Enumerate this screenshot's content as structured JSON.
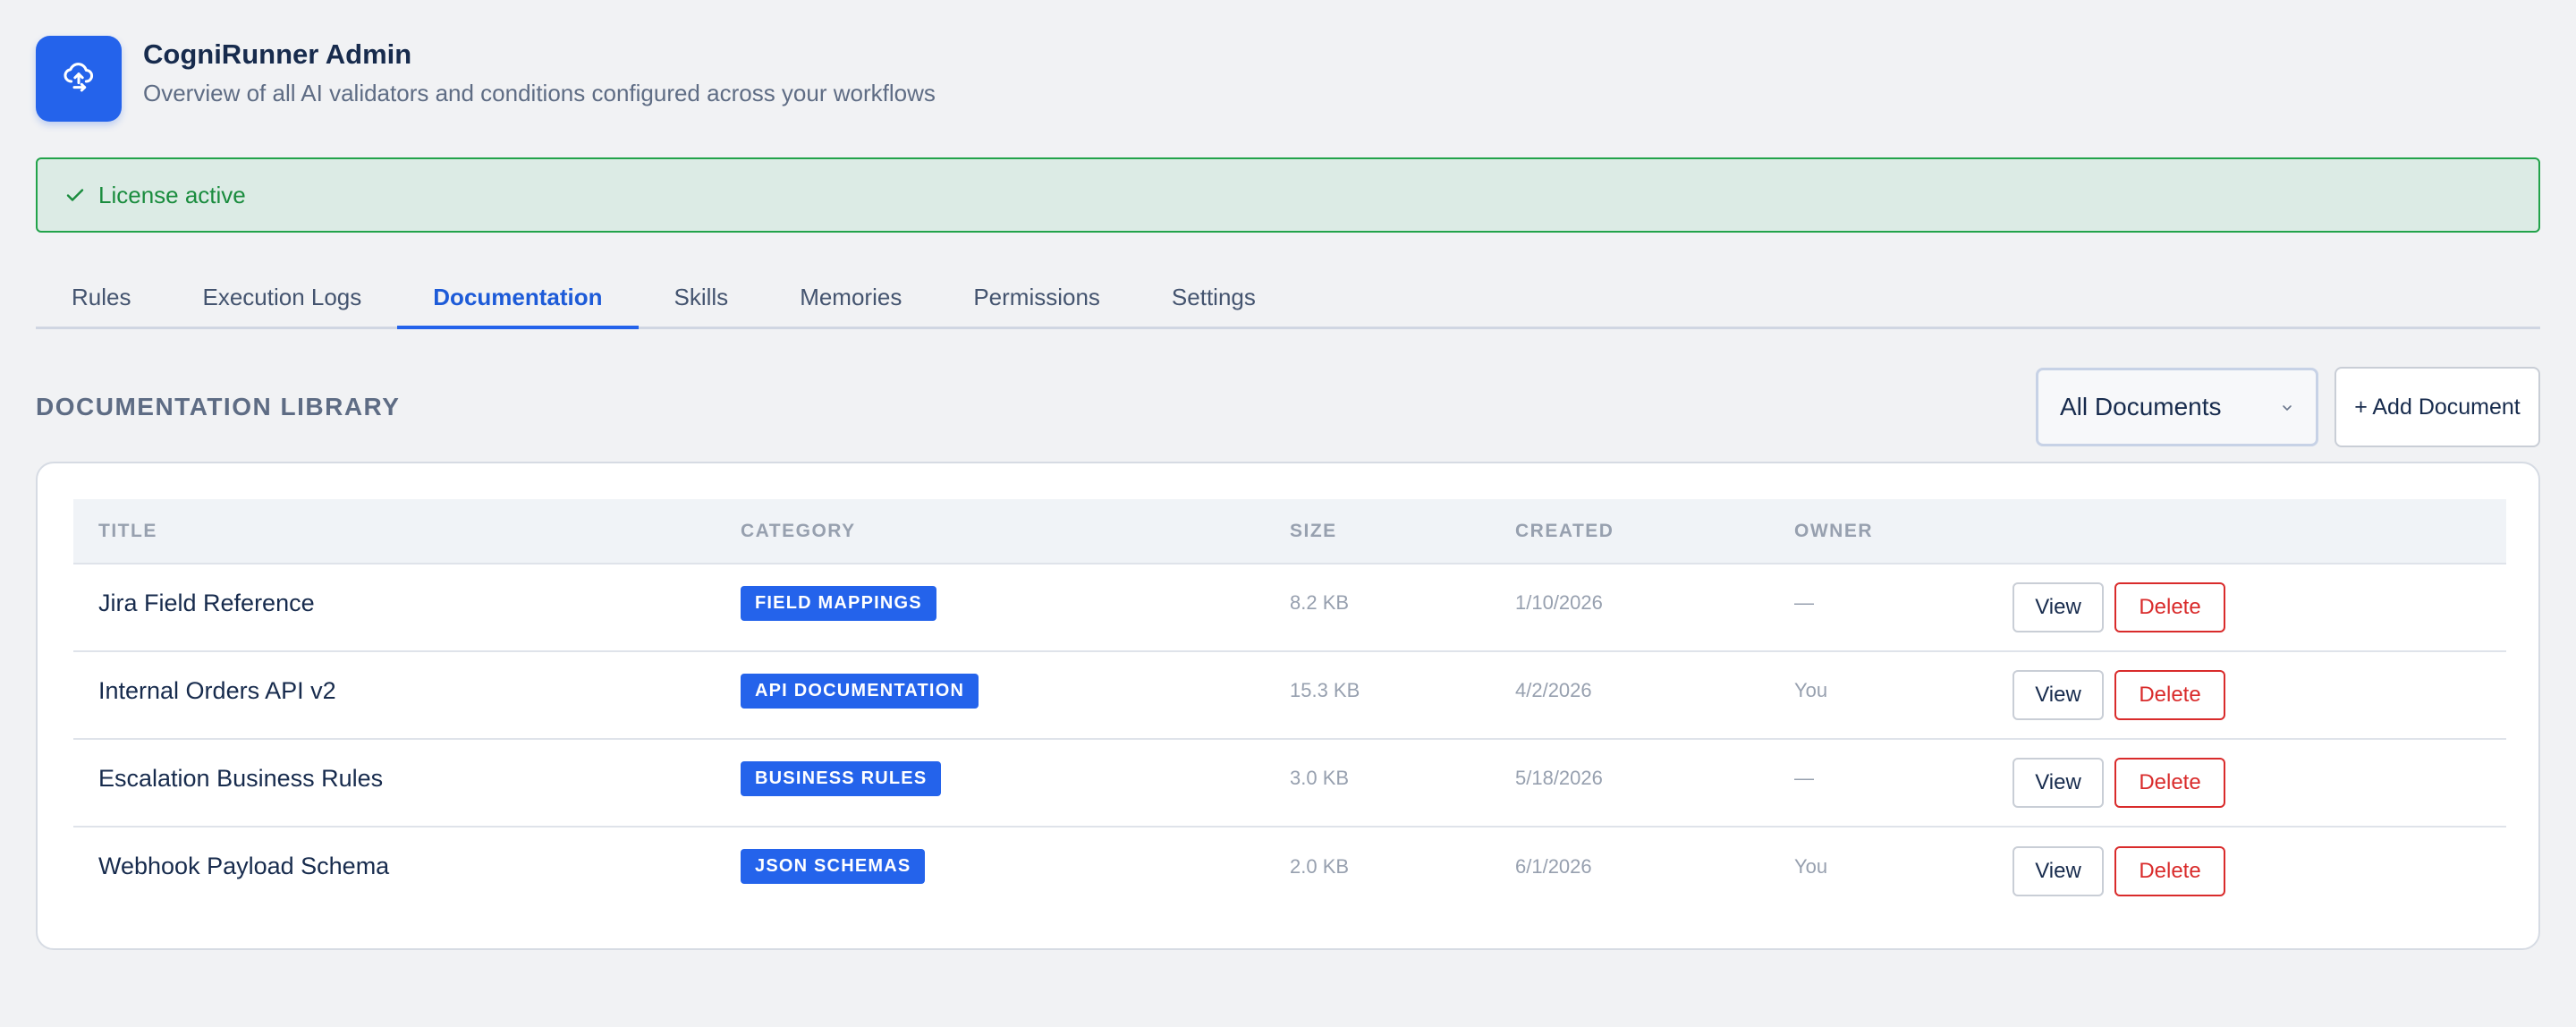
{
  "app": {
    "title": "CogniRunner Admin",
    "subtitle": "Overview of all AI validators and conditions configured across your workflows",
    "logo_icon": "cloud-upload-icon",
    "accent": "#2463eb"
  },
  "license": {
    "text": "License active",
    "icon": "check-icon",
    "color": "#22a34a"
  },
  "tabs": [
    {
      "label": "Rules",
      "active": false
    },
    {
      "label": "Execution Logs",
      "active": false
    },
    {
      "label": "Documentation",
      "active": true
    },
    {
      "label": "Skills",
      "active": false
    },
    {
      "label": "Memories",
      "active": false
    },
    {
      "label": "Permissions",
      "active": false
    },
    {
      "label": "Settings",
      "active": false
    }
  ],
  "library": {
    "title": "DOCUMENTATION LIBRARY",
    "filter_value": "All Documents",
    "add_label": "+ Add Document"
  },
  "table": {
    "columns": [
      "TITLE",
      "CATEGORY",
      "SIZE",
      "CREATED",
      "OWNER",
      ""
    ],
    "view_label": "View",
    "delete_label": "Delete",
    "rows": [
      {
        "title": "Jira Field Reference",
        "category": "FIELD MAPPINGS",
        "size": "8.2 KB",
        "created": "1/10/2026",
        "owner": "—"
      },
      {
        "title": "Internal Orders API v2",
        "category": "API DOCUMENTATION",
        "size": "15.3 KB",
        "created": "4/2/2026",
        "owner": "You"
      },
      {
        "title": "Escalation Business Rules",
        "category": "BUSINESS RULES",
        "size": "3.0 KB",
        "created": "5/18/2026",
        "owner": "—"
      },
      {
        "title": "Webhook Payload Schema",
        "category": "JSON SCHEMAS",
        "size": "2.0 KB",
        "created": "6/1/2026",
        "owner": "You"
      }
    ]
  }
}
